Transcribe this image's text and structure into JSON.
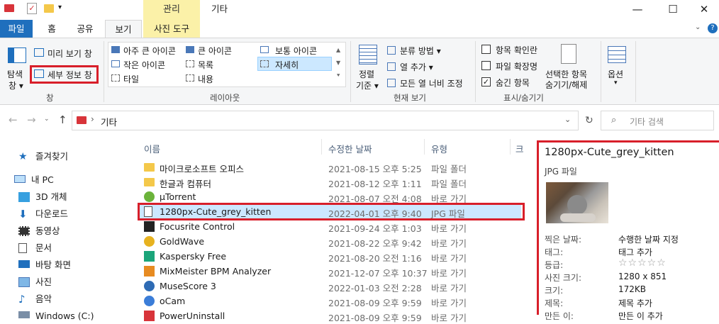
{
  "window": {
    "title": "기타",
    "contextual_tab_group": "관리",
    "minimize": "—",
    "maximize": "☐",
    "close": "✕"
  },
  "tabs": [
    "파일",
    "홈",
    "공유",
    "보기",
    "사진 도구"
  ],
  "ribbon": {
    "pane": {
      "nav_pane_line1": "탐색",
      "nav_pane_line2": "창 ▾",
      "preview_pane": "미리 보기 창",
      "details_pane": "세부 정보 창",
      "label": "창"
    },
    "layout": {
      "items": [
        "아주 큰 아이콘",
        "큰 아이콘",
        "보통 아이콘",
        "작은 아이콘",
        "목록",
        "자세히",
        "타일",
        "내용"
      ],
      "label": "레이아웃"
    },
    "current_view": {
      "sort_line1": "정렬",
      "sort_line2": "기준 ▾",
      "group_by": "분류 방법 ▾",
      "add_columns": "열 추가 ▾",
      "size_all_columns": "모든 열 너비 조정",
      "label": "현재 보기"
    },
    "show_hide": {
      "item_checkboxes": "항목 확인란",
      "file_extensions": "파일 확장명",
      "hidden_items": "숨긴 항목",
      "hide_selected_line1": "선택한 항목",
      "hide_selected_line2": "숨기기/해제",
      "label": "표시/숨기기"
    },
    "options": "옵션"
  },
  "address": {
    "path": "기타",
    "search_placeholder": "기타 검색"
  },
  "nav": [
    "즐겨찾기",
    "내 PC",
    "3D 개체",
    "다운로드",
    "동영상",
    "문서",
    "바탕 화면",
    "사진",
    "음악",
    "Windows (C:)"
  ],
  "columns": [
    "이름",
    "수정한 날짜",
    "유형",
    "크"
  ],
  "files": [
    {
      "name": "마이크로소프트 오피스",
      "date": "2021-08-15 오후 5:25",
      "type": "파일 폴더"
    },
    {
      "name": "한글과 컴퓨터",
      "date": "2021-08-12 오후 1:11",
      "type": "파일 폴더"
    },
    {
      "name": "µTorrent",
      "date": "2021-08-07 오전 4:08",
      "type": "바로 가기"
    },
    {
      "name": "1280px-Cute_grey_kitten",
      "date": "2022-04-01 오후 9:40",
      "type": "JPG 파일"
    },
    {
      "name": "Focusrite Control",
      "date": "2021-09-24 오후 1:03",
      "type": "바로 가기"
    },
    {
      "name": "GoldWave",
      "date": "2021-08-22 오후 9:42",
      "type": "바로 가기"
    },
    {
      "name": "Kaspersky Free",
      "date": "2021-08-20 오전 1:16",
      "type": "바로 가기"
    },
    {
      "name": "MixMeister BPM Analyzer",
      "date": "2021-12-07 오후 10:37",
      "type": "바로 가기"
    },
    {
      "name": "MuseScore 3",
      "date": "2022-01-03 오전 2:28",
      "type": "바로 가기"
    },
    {
      "name": "oCam",
      "date": "2021-08-09 오후 9:59",
      "type": "바로 가기"
    },
    {
      "name": "PowerUninstall",
      "date": "2021-08-09 오후 9:59",
      "type": "바로 가기"
    }
  ],
  "details": {
    "filename": "1280px-Cute_grey_kitten",
    "filetype": "JPG 파일",
    "props": [
      {
        "k": "찍은 날짜:",
        "v": "수행한 날짜 지정"
      },
      {
        "k": "태그:",
        "v": "태그 추가"
      },
      {
        "k": "등급:",
        "v": "☆☆☆☆☆"
      },
      {
        "k": "사진 크기:",
        "v": "1280 x 851"
      },
      {
        "k": "크기:",
        "v": "172KB"
      },
      {
        "k": "제목:",
        "v": "제목 추가"
      },
      {
        "k": "만든 이:",
        "v": "만든 이 추가"
      }
    ]
  }
}
